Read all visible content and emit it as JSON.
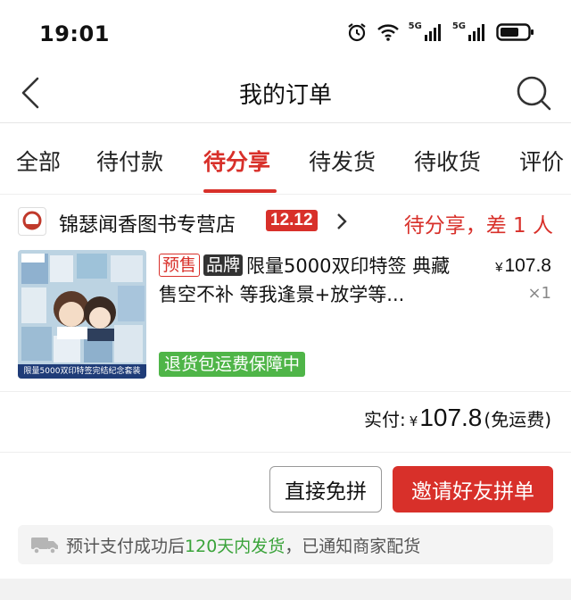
{
  "status_bar": {
    "time": "19:01",
    "signal1_label": "5G",
    "signal2_label": "5G"
  },
  "nav": {
    "title": "我的订单",
    "back_icon": "chevron-left-icon",
    "search_icon": "search-icon"
  },
  "tabs": [
    {
      "label": "全部",
      "active": false
    },
    {
      "label": "待付款",
      "active": false
    },
    {
      "label": "待分享",
      "active": true
    },
    {
      "label": "待发货",
      "active": false
    },
    {
      "label": "待收货",
      "active": false
    },
    {
      "label": "评价",
      "active": false
    }
  ],
  "order": {
    "shop_name": "锦瑟闻香图书专营店",
    "shop_badge": "12.12",
    "status": "待分享，差 1 人",
    "product": {
      "tag_presale": "预售",
      "tag_brand": "品牌",
      "title": "限量5000双印特签 典藏售空不补 等我逢景+放学等...",
      "price_symbol": "¥",
      "price": "107.8",
      "quantity": "×1",
      "image_caption": "限量5000双印特签完结纪念套装",
      "guarantee": "退货包运费保障中"
    },
    "total": {
      "label": "实付:",
      "symbol": "¥",
      "amount": "107.8",
      "note": "(免运费)"
    },
    "buttons": {
      "direct": "直接免拼",
      "invite": "邀请好友拼单"
    },
    "shipping": {
      "prefix": "预计支付成功后",
      "highlight": "120天内发货",
      "suffix": "，已通知商家配货"
    }
  },
  "colors": {
    "accent": "#d8302a",
    "guarantee_green": "#4fb548",
    "shipping_green": "#3aa33a"
  }
}
